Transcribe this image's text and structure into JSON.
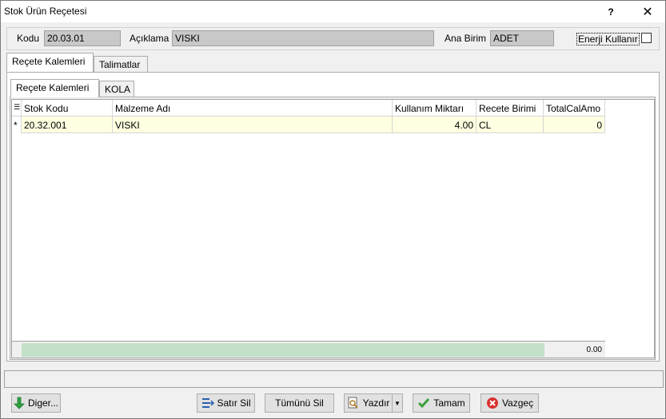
{
  "window": {
    "title": "Stok Ürün Reçetesi",
    "help_label": "?",
    "close_label": "✕"
  },
  "header": {
    "kodu_label": "Kodu",
    "kodu_value": "20.03.01",
    "aciklama_label": "Açıklama",
    "aciklama_value": "VISKI",
    "ana_birim_label": "Ana Birim",
    "ana_birim_value": "ADET",
    "enerji_label": "Enerji Kullanır",
    "enerji_checked": false
  },
  "outer_tabs": [
    {
      "label": "Reçete Kalemleri",
      "active": true
    },
    {
      "label": "Talimatlar",
      "active": false
    }
  ],
  "inner_tabs": [
    {
      "label": "Reçete Kalemleri",
      "active": true
    },
    {
      "label": "KOLA",
      "active": false
    }
  ],
  "grid": {
    "columns": [
      "Stok Kodu",
      "Malzeme Adı",
      "Kullanım Miktarı",
      "Recete Birimi",
      "TotalCalAmo"
    ],
    "rows": [
      {
        "marker": "*",
        "stok_kodu": "20.32.001",
        "malzeme_adi": "VISKI",
        "kullanim_miktari": "4.00",
        "recete_birimi": "CL",
        "total_cal_amo": "0"
      }
    ],
    "footer_total": "0.00"
  },
  "buttons": {
    "diger": "Diger...",
    "satir_sil": "Satır Sil",
    "tumunu_sil": "Tümünü Sil",
    "yazdir": "Yazdır",
    "tamam": "Tamam",
    "vazgec": "Vazgeç"
  },
  "colors": {
    "row_highlight": "#ffffe1",
    "footer_green": "#c3e0c8",
    "field_bg": "#c8c8c8"
  }
}
